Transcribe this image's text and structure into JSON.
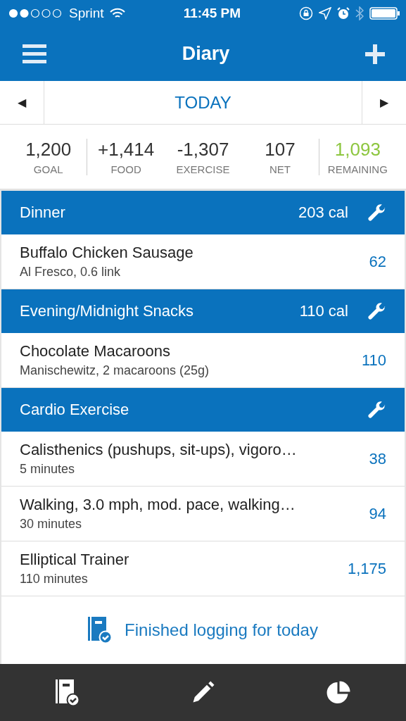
{
  "status_bar": {
    "carrier": "Sprint",
    "time": "11:45 PM"
  },
  "nav": {
    "title": "Diary"
  },
  "date_bar": {
    "prev": "◀",
    "label": "TODAY",
    "next": "▶"
  },
  "summary": [
    {
      "value": "1,200",
      "label": "GOAL",
      "color": "#333333"
    },
    {
      "value": "+1,414",
      "label": "FOOD",
      "color": "#333333"
    },
    {
      "value": "-1,307",
      "label": "EXERCISE",
      "color": "#333333"
    },
    {
      "value": "107",
      "label": "NET",
      "color": "#333333"
    },
    {
      "value": "1,093",
      "label": "REMAINING",
      "color": "#8dc63f"
    }
  ],
  "sections": [
    {
      "title": "Dinner",
      "calories": "203 cal",
      "items": [
        {
          "name": "Buffalo Chicken Sausage",
          "detail": "Al Fresco, 0.6 link",
          "value": "62"
        }
      ]
    },
    {
      "title": "Evening/Midnight Snacks",
      "calories": "110 cal",
      "items": [
        {
          "name": "Chocolate Macaroons",
          "detail": "Manischewitz, 2 macaroons (25g)",
          "value": "110"
        }
      ]
    },
    {
      "title": "Cardio Exercise",
      "items": [
        {
          "name": "Calisthenics (pushups, sit-ups), vigoro…",
          "detail": "5 minutes",
          "value": "38"
        },
        {
          "name": "Walking, 3.0 mph, mod. pace, walking…",
          "detail": "30 minutes",
          "value": "94"
        },
        {
          "name": "Elliptical Trainer",
          "detail": "110 minutes",
          "value": "1,175"
        }
      ]
    }
  ],
  "finish": {
    "label": "Finished logging for today"
  },
  "tab_bar": [
    {
      "kind": "diary"
    },
    {
      "kind": "edit"
    },
    {
      "kind": "progress"
    }
  ]
}
